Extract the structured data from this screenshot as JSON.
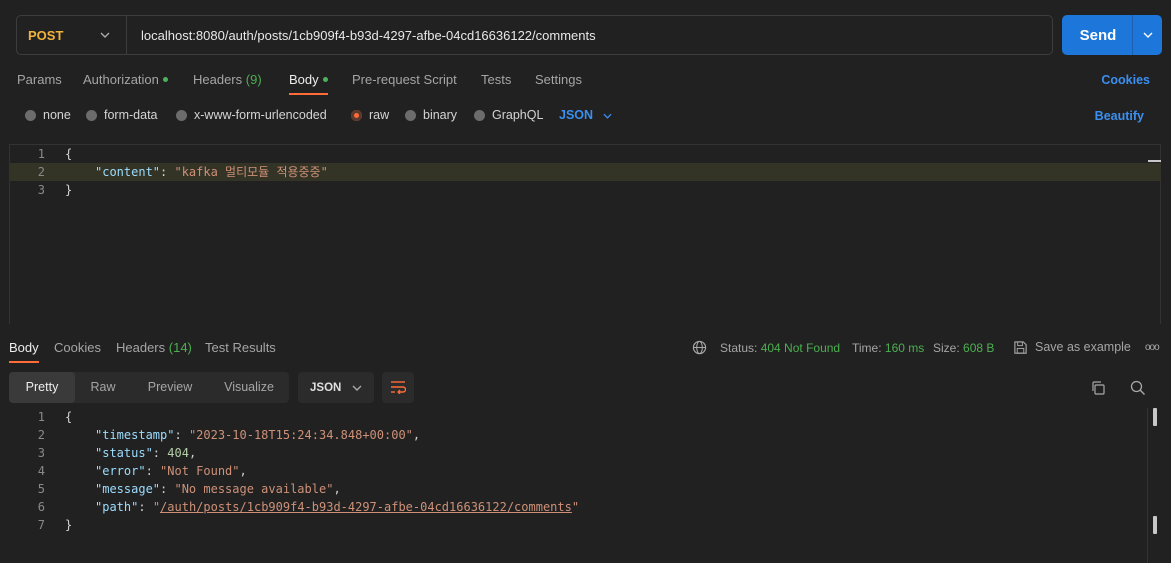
{
  "request": {
    "method": "POST",
    "url": "localhost:8080/auth/posts/1cb909f4-b93d-4297-afbe-04cd16636122/comments",
    "send_label": "Send"
  },
  "req_tabs": {
    "params": "Params",
    "authorization": "Authorization",
    "headers": "Headers",
    "headers_count": "(9)",
    "body": "Body",
    "prerequest": "Pre-request Script",
    "tests": "Tests",
    "settings": "Settings",
    "cookies": "Cookies"
  },
  "body_types": {
    "none": "none",
    "form_data": "form-data",
    "urlencoded": "x-www-form-urlencoded",
    "raw": "raw",
    "binary": "binary",
    "graphql": "GraphQL",
    "format": "JSON",
    "beautify": "Beautify"
  },
  "request_body": {
    "line_numbers": [
      "1",
      "2",
      "3"
    ],
    "open_brace": "{",
    "key": "\"content\"",
    "colon": ": ",
    "value": "\"kafka 멀티모듈 적용중중\"",
    "close_brace": "}"
  },
  "resp_tabs": {
    "body": "Body",
    "cookies": "Cookies",
    "headers": "Headers",
    "headers_count": "(14)",
    "test_results": "Test Results"
  },
  "resp_status": {
    "status_label": "Status:",
    "status_value": "404 Not Found",
    "time_label": "Time:",
    "time_value": "160 ms",
    "size_label": "Size:",
    "size_value": "608 B",
    "save_example": "Save as example",
    "more": "ooo"
  },
  "view_modes": {
    "pretty": "Pretty",
    "raw": "Raw",
    "preview": "Preview",
    "visualize": "Visualize",
    "format": "JSON"
  },
  "response_body": {
    "line_numbers": [
      "1",
      "2",
      "3",
      "4",
      "5",
      "6",
      "7"
    ],
    "open_brace": "{",
    "close_brace": "}",
    "timestamp_key": "\"timestamp\"",
    "timestamp_val": "\"2023-10-18T15:24:34.848+00:00\"",
    "status_key": "\"status\"",
    "status_val": "404",
    "error_key": "\"error\"",
    "error_val": "\"Not Found\"",
    "message_key": "\"message\"",
    "message_val": "\"No message available\"",
    "path_key": "\"path\"",
    "path_q1": "\"",
    "path_val": "/auth/posts/1cb909f4-b93d-4297-afbe-04cd16636122/comments",
    "path_q2": "\"",
    "colon": ": ",
    "comma": ","
  },
  "colors": {
    "accent": "#ff6c37",
    "send": "#1d76d9",
    "method": "#f2b33d",
    "success": "#4caf50",
    "link": "#3b8ff0"
  }
}
